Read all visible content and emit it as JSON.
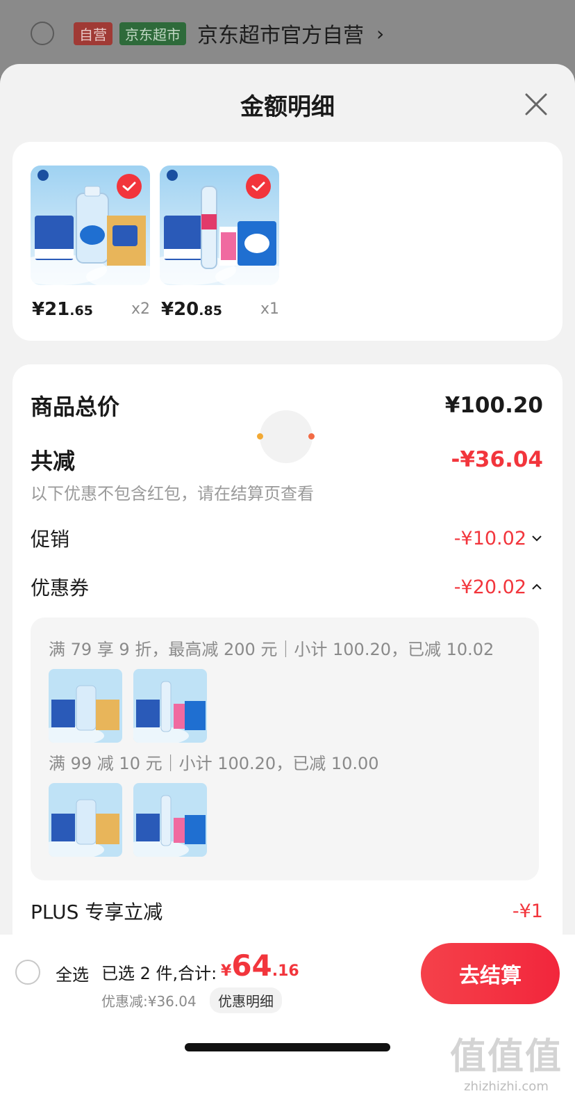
{
  "background_page": {
    "tag_self": "自营",
    "tag_market": "京东超市",
    "shop_name": "京东超市官方自营",
    "chevron": "›"
  },
  "sheet": {
    "title": "金额明细"
  },
  "products": [
    {
      "price_int": "¥21",
      "price_dec": ".65",
      "qty": "x2",
      "checked": true
    },
    {
      "price_int": "¥20",
      "price_dec": ".85",
      "qty": "x1",
      "checked": true
    }
  ],
  "summary": {
    "total_label": "商品总价",
    "total_value": "¥100.20",
    "reduce_label": "共减",
    "reduce_value": "-¥36.04",
    "note": "以下优惠不包含红包，请在结算页查看",
    "promo_label": "促销",
    "promo_value": "-¥10.02",
    "coupon_label": "优惠券",
    "coupon_value": "-¥20.02",
    "plus_label": "PLUS 专享立减",
    "plus_value": "-¥1"
  },
  "coupons": [
    {
      "text": "满 79 享 9 折，最高减 200 元｜小计 100.20，已减 10.02"
    },
    {
      "text": "满 99 减 10 元｜小计 100.20，已减 10.00"
    }
  ],
  "bottom": {
    "select_all": "全选",
    "selected_summary": "已选 2 件,合计:",
    "total_currency": "¥",
    "total_int": "64",
    "total_dec": ".16",
    "discount": "优惠减:¥36.04",
    "detail_chip": "优惠明细",
    "checkout": "去结算"
  },
  "watermark": {
    "big": "值值值",
    "small": "zhizhizhi.com"
  },
  "colors": {
    "accent_red": "#f2353c",
    "sheet_bg": "#f2f2f2"
  }
}
